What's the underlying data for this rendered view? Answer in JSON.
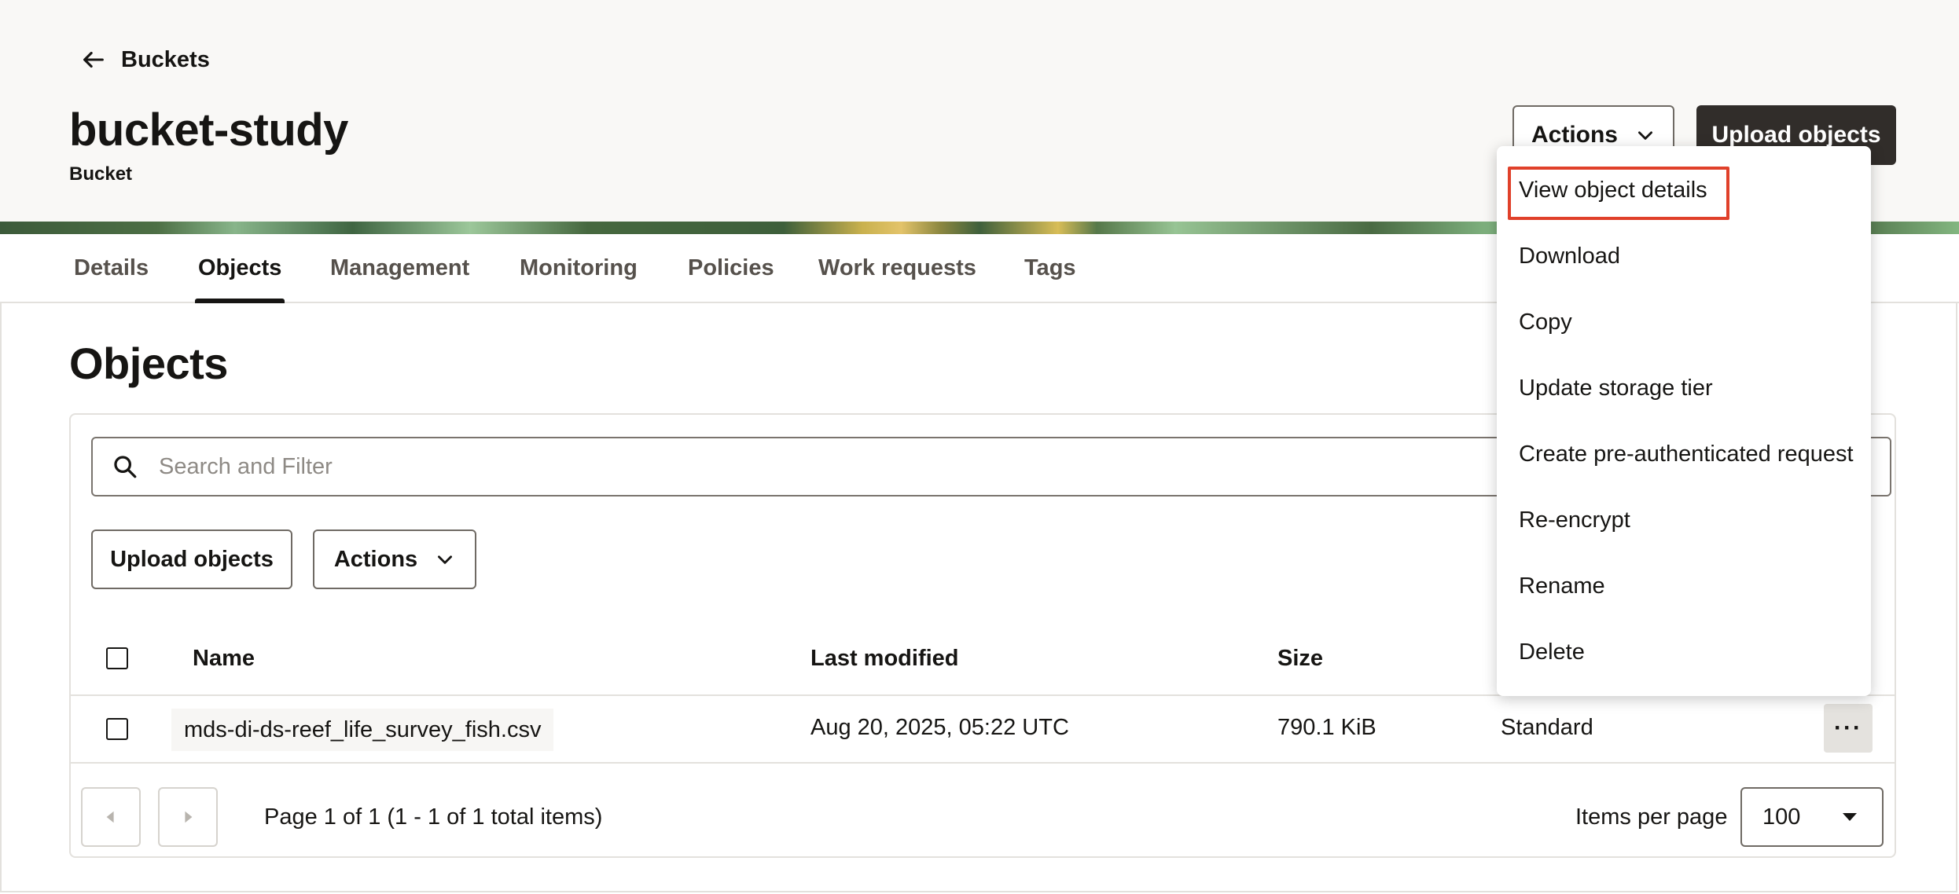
{
  "header": {
    "back_label": "Buckets",
    "title": "bucket-study",
    "subtitle": "Bucket",
    "actions_label": "Actions",
    "upload_label": "Upload objects"
  },
  "tabs": [
    {
      "label": "Details",
      "active": false
    },
    {
      "label": "Objects",
      "active": true
    },
    {
      "label": "Management",
      "active": false
    },
    {
      "label": "Monitoring",
      "active": false
    },
    {
      "label": "Policies",
      "active": false
    },
    {
      "label": "Work requests",
      "active": false
    },
    {
      "label": "Tags",
      "active": false
    }
  ],
  "objects": {
    "title": "Objects",
    "search_placeholder": "Search and Filter",
    "upload_label": "Upload objects",
    "actions_label": "Actions",
    "columns": [
      "Name",
      "Last modified",
      "Size"
    ],
    "rows": [
      {
        "name": "mds-di-ds-reef_life_survey_fish.csv",
        "last_modified": "Aug 20, 2025, 05:22 UTC",
        "size": "790.1 KiB",
        "storage_tier": "Standard",
        "more_label": "···"
      }
    ],
    "pagination": {
      "text": "Page 1 of 1 (1 - 1 of 1 total items)",
      "items_per_page_label": "Items per page",
      "items_per_page": "100"
    }
  },
  "row_menu": {
    "items": [
      "View object details",
      "Download",
      "Copy",
      "Update storage tier",
      "Create pre-authenticated request",
      "Re-encrypt",
      "Rename",
      "Delete"
    ],
    "highlighted": "View object details",
    "highlight_color": "#e0402a"
  },
  "colors": {
    "primary_button": "#312d2a",
    "header_bg": "#f9f8f6",
    "text": "#161513"
  }
}
